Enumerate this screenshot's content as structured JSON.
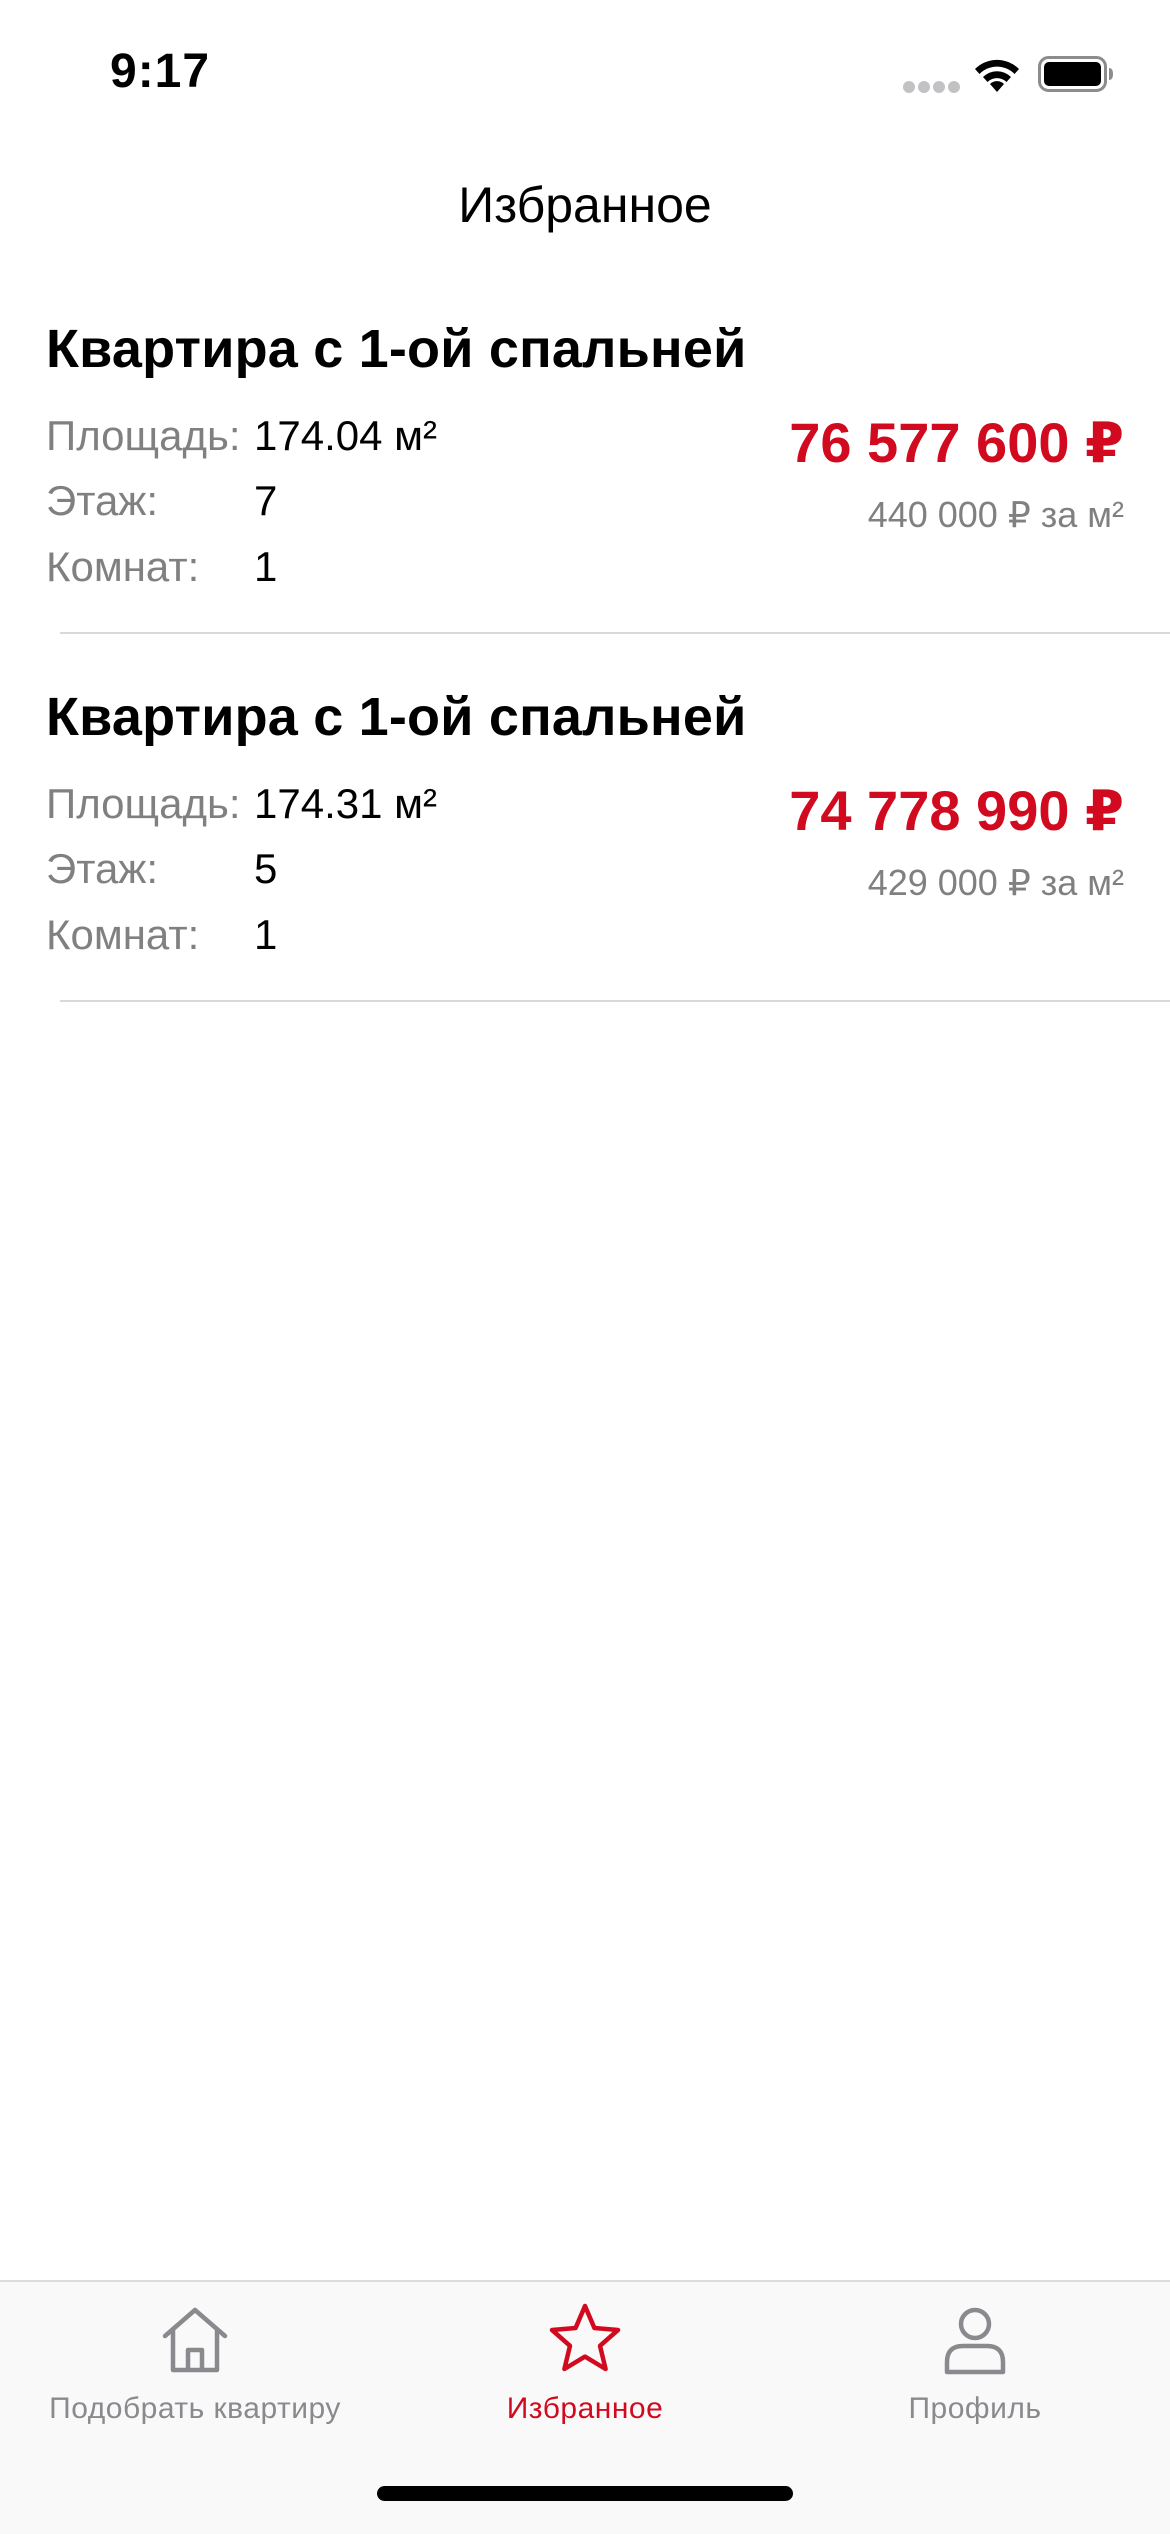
{
  "status_bar": {
    "time": "9:17"
  },
  "nav": {
    "title": "Избранное"
  },
  "listings": [
    {
      "title": "Квартира с 1-ой спальней",
      "area_label": "Площадь:",
      "area_value": "174.04 м²",
      "floor_label": "Этаж:",
      "floor_value": "7",
      "rooms_label": "Комнат:",
      "rooms_value": "1",
      "price": "76 577 600 ₽",
      "price_per_m": "440 000 ₽ за м²"
    },
    {
      "title": "Квартира с 1-ой спальней",
      "area_label": "Площадь:",
      "area_value": "174.31 м²",
      "floor_label": "Этаж:",
      "floor_value": "5",
      "rooms_label": "Комнат:",
      "rooms_value": "1",
      "price": "74 778 990 ₽",
      "price_per_m": "429 000 ₽ за м²"
    }
  ],
  "tab_bar": {
    "tabs": [
      {
        "label": "Подобрать квартиру",
        "icon": "home-icon",
        "active": false
      },
      {
        "label": "Избранное",
        "icon": "star-icon",
        "active": true
      },
      {
        "label": "Профиль",
        "icon": "person-icon",
        "active": false
      }
    ]
  },
  "colors": {
    "accent": "#d10a1f",
    "secondary_text": "#808080",
    "tab_inactive": "#8a8a8e",
    "separator": "#d9d9db"
  }
}
